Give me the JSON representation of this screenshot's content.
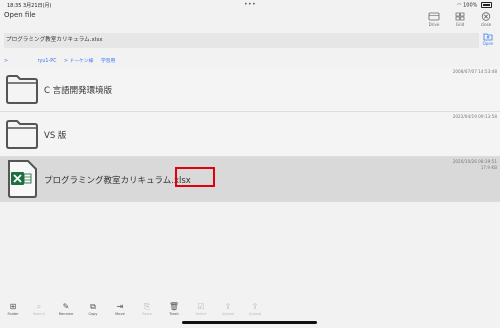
{
  "status_bar": {
    "time_date": "18:35  3月21日(月)",
    "dots": "•••",
    "battery": "100%"
  },
  "header": {
    "title": "Open file",
    "buttons": [
      {
        "label": "Drive",
        "icon": "drive-icon"
      },
      {
        "label": "Grid",
        "icon": "grid-icon"
      },
      {
        "label": "close",
        "icon": "close-icon"
      }
    ]
  },
  "path_field": {
    "value": "プログラミング教室カリキュラム.xlsx"
  },
  "open_button": {
    "label": "Open",
    "icon": "open-icon"
  },
  "breadcrumb": {
    "items": [
      ">",
      "ryu1-PC",
      "> ドーケン様",
      "学習用"
    ]
  },
  "files": [
    {
      "type": "folder",
      "name": "C 言語開発環境版",
      "date": "2008/07/07 14:53:48",
      "size": "",
      "icon": "folder-icon"
    },
    {
      "type": "folder",
      "name": "VS 版",
      "date": "2022/04/19 09:13:58",
      "size": "",
      "icon": "folder-icon"
    },
    {
      "type": "xlsx",
      "name": "プログラミング教室カリキュラム.xlsx",
      "date": "2020/10/26 08:39:51",
      "size": "17.9 KB",
      "icon": "excel-file-icon",
      "selected": true
    }
  ],
  "toolbar": {
    "items": [
      {
        "label": "Folder",
        "glyph": "⊞",
        "enabled": true
      },
      {
        "label": "Search",
        "glyph": "⌕",
        "enabled": false
      },
      {
        "label": "Rename",
        "glyph": "✎",
        "enabled": true
      },
      {
        "label": "Copy",
        "glyph": "⧉",
        "enabled": true
      },
      {
        "label": "Move",
        "glyph": "⇥",
        "enabled": true
      },
      {
        "label": "Paste",
        "glyph": "⎘",
        "enabled": false
      },
      {
        "label": "Trash",
        "glyph": "🗑",
        "enabled": true
      },
      {
        "label": "Select",
        "glyph": "☑",
        "enabled": false
      },
      {
        "label": "Upload",
        "glyph": "⇪",
        "enabled": false
      },
      {
        "label": "Upload",
        "glyph": "⇪",
        "enabled": false
      }
    ]
  },
  "colors": {
    "accent": "#3478f6",
    "highlight": "#e3000b",
    "excel": "#1d6f42"
  }
}
